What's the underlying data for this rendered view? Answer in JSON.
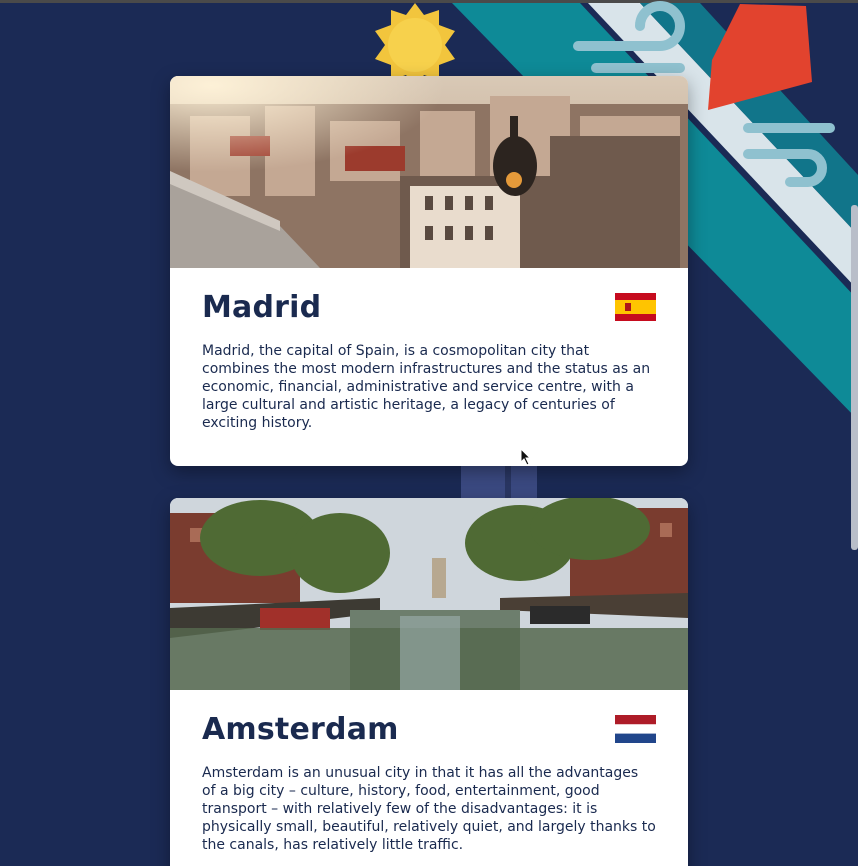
{
  "cities": [
    {
      "name": "Madrid",
      "description": "Madrid, the capital of Spain, is a cosmopolitan city that combines the most modern infrastructures and the status as an economic, financial, administrative and service centre, with a large cultural and artistic heritage, a legacy of centuries of exciting history.",
      "flag": "spain-flag-icon",
      "photo": "madrid-cityscape-photo"
    },
    {
      "name": "Amsterdam",
      "description": "Amsterdam is an unusual city in that it has all the advantages of a big city – culture, history, food, entertainment, good transport – with relatively few of the disadvantages: it is physically small, beautiful, relatively quiet, and largely thanks to the canals, has relatively little traffic.",
      "flag": "netherlands-flag-icon",
      "photo": "amsterdam-canal-photo"
    }
  ],
  "colors": {
    "background": "#1b2a55",
    "card": "#ffffff",
    "text": "#1a2a4f",
    "stripe_teal": "#0e8a97",
    "stripe_light": "#d9e4ea",
    "sun": "#f2c53d",
    "kite": "#e2432e"
  }
}
